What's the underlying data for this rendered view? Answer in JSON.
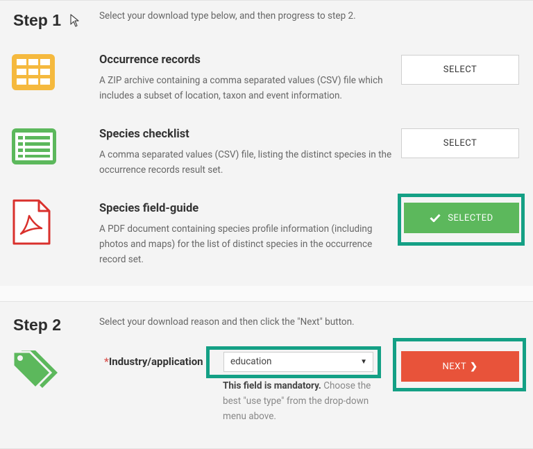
{
  "step1": {
    "title": "Step 1",
    "intro": "Select your download type below, and then progress to step 2.",
    "options": [
      {
        "icon": "table-grid-icon",
        "title": "Occurrence records",
        "description": "A ZIP archive containing a comma separated values (CSV) file which includes a subset of location, taxon and event information.",
        "button_label": "SELECT",
        "selected": false
      },
      {
        "icon": "list-icon",
        "title": "Species checklist",
        "description": "A comma separated values (CSV) file, listing the distinct species in the occurrence records result set.",
        "button_label": "SELECT",
        "selected": false
      },
      {
        "icon": "pdf-document-icon",
        "title": "Species field-guide",
        "description": "A PDF document containing species profile information (including photos and maps) for the list of distinct species in the occurrence record set.",
        "button_label": "SELECTED",
        "selected": true
      }
    ]
  },
  "step2": {
    "title": "Step 2",
    "intro": "Select your download reason and then click the \"Next\" button.",
    "field_required_marker": "*",
    "field_label": "Industry/application",
    "dropdown_value": "education",
    "help_bold": "This field is mandatory.",
    "help_text": "Choose the best \"use type\" from the drop-down menu above.",
    "next_label": "NEXT"
  },
  "colors": {
    "highlight": "#14a085",
    "selected_green": "#5cb85c",
    "next_red": "#e8533a",
    "icon_yellow": "#f5b93e",
    "icon_green": "#5cb85c",
    "icon_red": "#d9302c"
  }
}
